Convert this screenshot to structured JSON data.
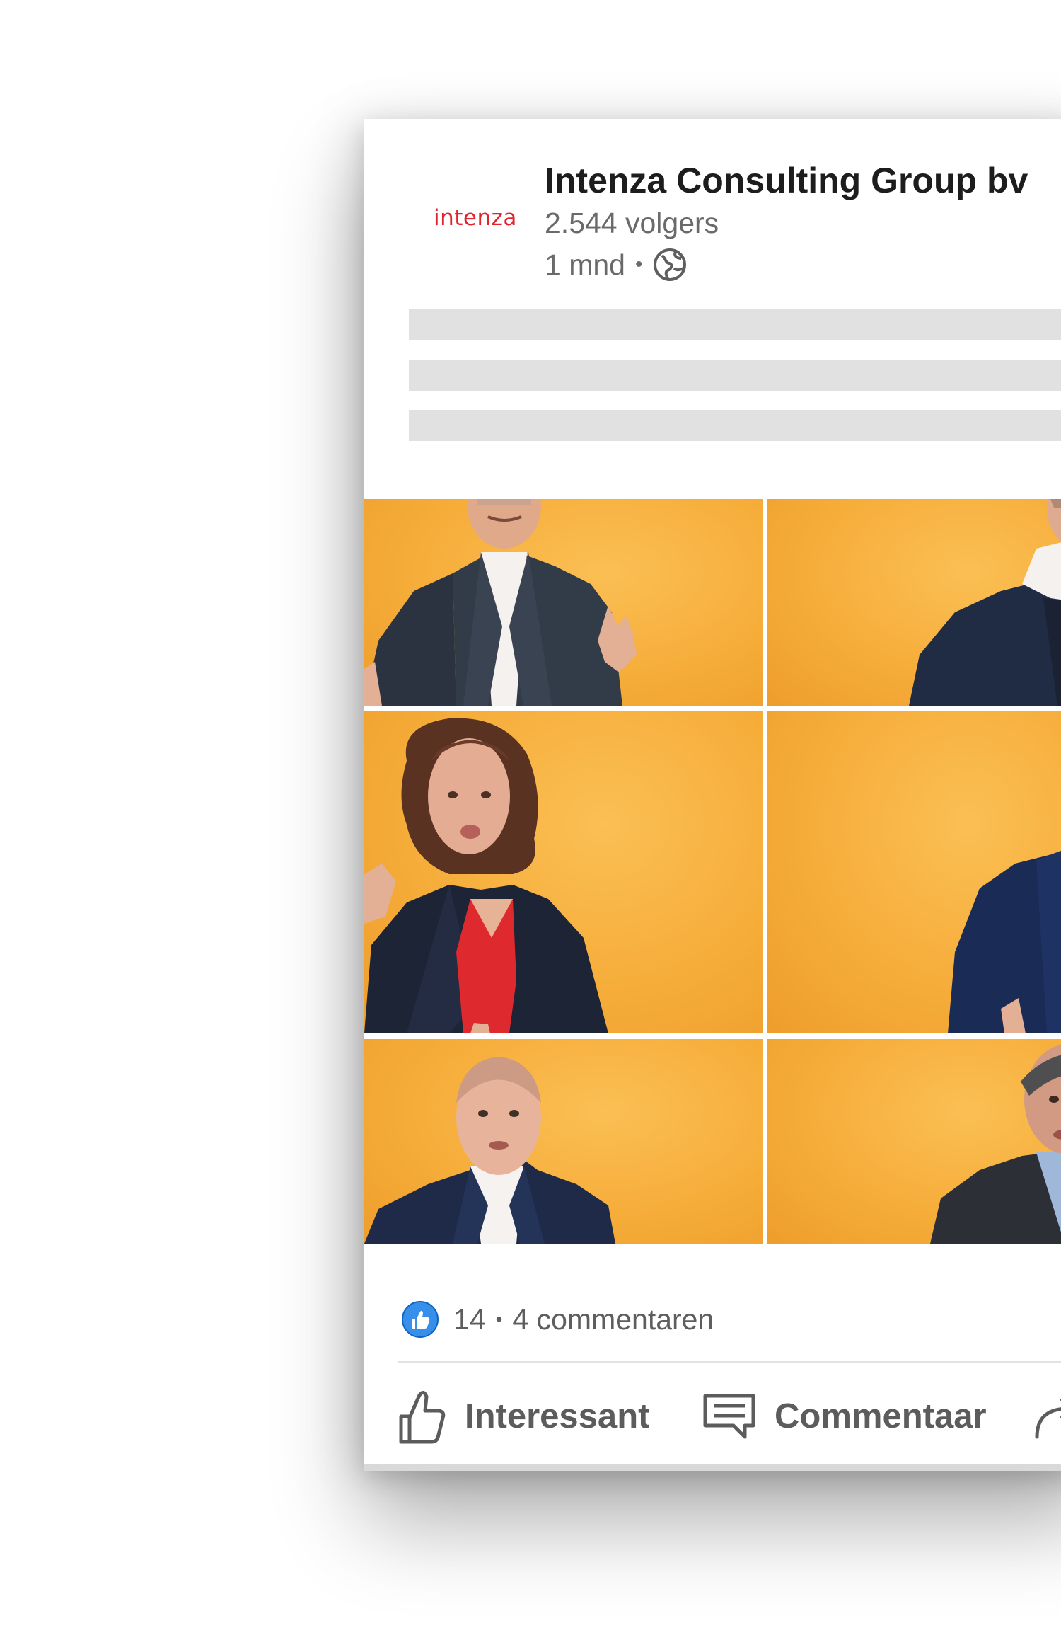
{
  "post": {
    "author": {
      "name": "Intenza Consulting Group bv",
      "followers": "2.544 volgers",
      "time": "1 mnd",
      "separator": "•",
      "logo_text": "intenza",
      "visibility_icon": "globe-icon"
    },
    "media": {
      "type": "photo-grid",
      "tiles": [
        {
          "subject": "man in dark suit gesturing"
        },
        {
          "subject": "man in navy jacket"
        },
        {
          "subject": "woman with curly hair in red top"
        },
        {
          "subject": "man in blue suit"
        },
        {
          "subject": "bald man in navy suit"
        },
        {
          "subject": "man with grey hair in dark suit"
        }
      ],
      "background_color": "#f7b040"
    },
    "social": {
      "reaction_icon": "like-badge-icon",
      "reaction_count": "14",
      "separator": "•",
      "comments": "4 commentaren"
    },
    "actions": [
      {
        "label": "Interessant",
        "icon": "thumbs-up-icon"
      },
      {
        "label": "Commentaar",
        "icon": "comment-icon"
      },
      {
        "label": "",
        "icon": "share-icon"
      }
    ]
  },
  "colors": {
    "brand": "#e0242f",
    "like_blue": "#378fe9",
    "text_primary": "#1d1d1d",
    "text_secondary": "#6a6a6a",
    "placeholder": "#e1e1e1"
  }
}
